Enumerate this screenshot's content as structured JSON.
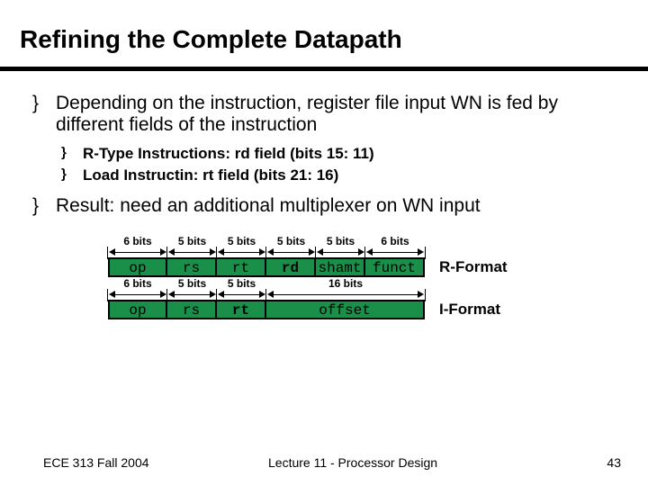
{
  "title": "Refining the Complete Datapath",
  "bullets": {
    "main1": "Depending on the instruction, register file input WN is fed by different fields of the instruction",
    "sub1": "R-Type Instructions:  rd field (bits 15: 11)",
    "sub2": "Load Instructin: rt field (bits 21: 16)",
    "main2": "Result: need an additional multiplexer on WN input"
  },
  "bullet_glyph": "}",
  "bits": {
    "b6": "6 bits",
    "b5": "5 bits",
    "b16": "16 bits"
  },
  "rformat": {
    "op": "op",
    "rs": "rs",
    "rt": "rt",
    "rd": "rd",
    "shamt": "shamt",
    "funct": "funct",
    "label": "R-Format"
  },
  "iformat": {
    "op": "op",
    "rs": "rs",
    "rt": "rt",
    "offset": "offset",
    "label": "I-Format"
  },
  "footer": {
    "left": "ECE 313 Fall 2004",
    "mid": "Lecture 11 - Processor Design",
    "right": "43"
  }
}
